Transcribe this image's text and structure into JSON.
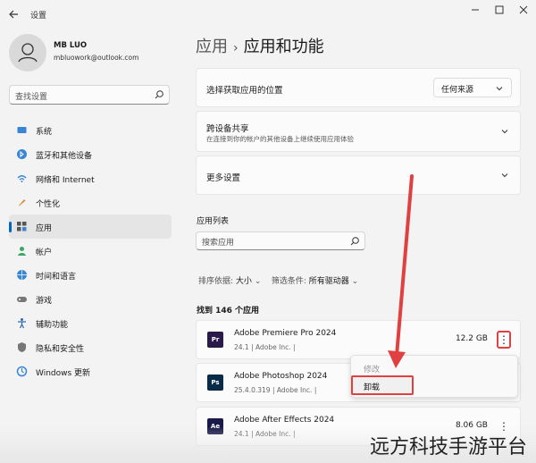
{
  "window": {
    "title": "设置"
  },
  "user": {
    "name": "MB LUO",
    "email": "mbluowork@outlook.com"
  },
  "sidebar": {
    "search_placeholder": "查找设置",
    "items": [
      {
        "label": "系统",
        "icon": "monitor-icon"
      },
      {
        "label": "蓝牙和其他设备",
        "icon": "bluetooth-icon"
      },
      {
        "label": "网络和 Internet",
        "icon": "wifi-icon"
      },
      {
        "label": "个性化",
        "icon": "brush-icon"
      },
      {
        "label": "应用",
        "icon": "apps-icon",
        "active": true
      },
      {
        "label": "帐户",
        "icon": "person-icon"
      },
      {
        "label": "时间和语言",
        "icon": "globe-icon"
      },
      {
        "label": "游戏",
        "icon": "gamepad-icon"
      },
      {
        "label": "辅助功能",
        "icon": "accessibility-icon"
      },
      {
        "label": "隐私和安全性",
        "icon": "shield-icon"
      },
      {
        "label": "Windows 更新",
        "icon": "update-icon"
      }
    ]
  },
  "main": {
    "breadcrumb": {
      "parent": "应用",
      "sep": "›",
      "current": "应用和功能"
    },
    "source_card": {
      "title": "选择获取应用的位置",
      "dropdown_value": "任何来源"
    },
    "share_card": {
      "title": "跨设备共享",
      "subtitle": "在连接到你的帐户的其他设备上继续使用应用体验"
    },
    "more_card": {
      "title": "更多设置"
    },
    "apps_list_label": "应用列表",
    "apps_search_placeholder": "搜索应用",
    "sort_label": "排序依据:",
    "sort_value": "大小",
    "filter_label": "筛选条件:",
    "filter_value": "所有驱动器",
    "found_text": "找到 146 个应用",
    "apps": [
      {
        "name": "Adobe Premiere Pro 2024",
        "meta": "24.1  |  Adobe Inc.  |",
        "size": "12.2 GB",
        "icon_text": "Pr",
        "icon_color": "#2a1a4a"
      },
      {
        "name": "Adobe Photoshop 2024",
        "meta": "25.4.0.319  |  Adobe Inc.  |",
        "size": "",
        "icon_text": "Ps",
        "icon_color": "#0a2a4a"
      },
      {
        "name": "Adobe After Effects 2024",
        "meta": "24.1  |  Adobe Inc.  |",
        "size": "8.06 GB",
        "icon_text": "Ae",
        "icon_color": "#1a1a4a"
      }
    ],
    "context_menu": {
      "modify": "修改",
      "uninstall": "卸载"
    }
  },
  "watermark": "远方科技手游平台",
  "colors": {
    "accent": "#0067c0",
    "highlight": "#e04040"
  }
}
